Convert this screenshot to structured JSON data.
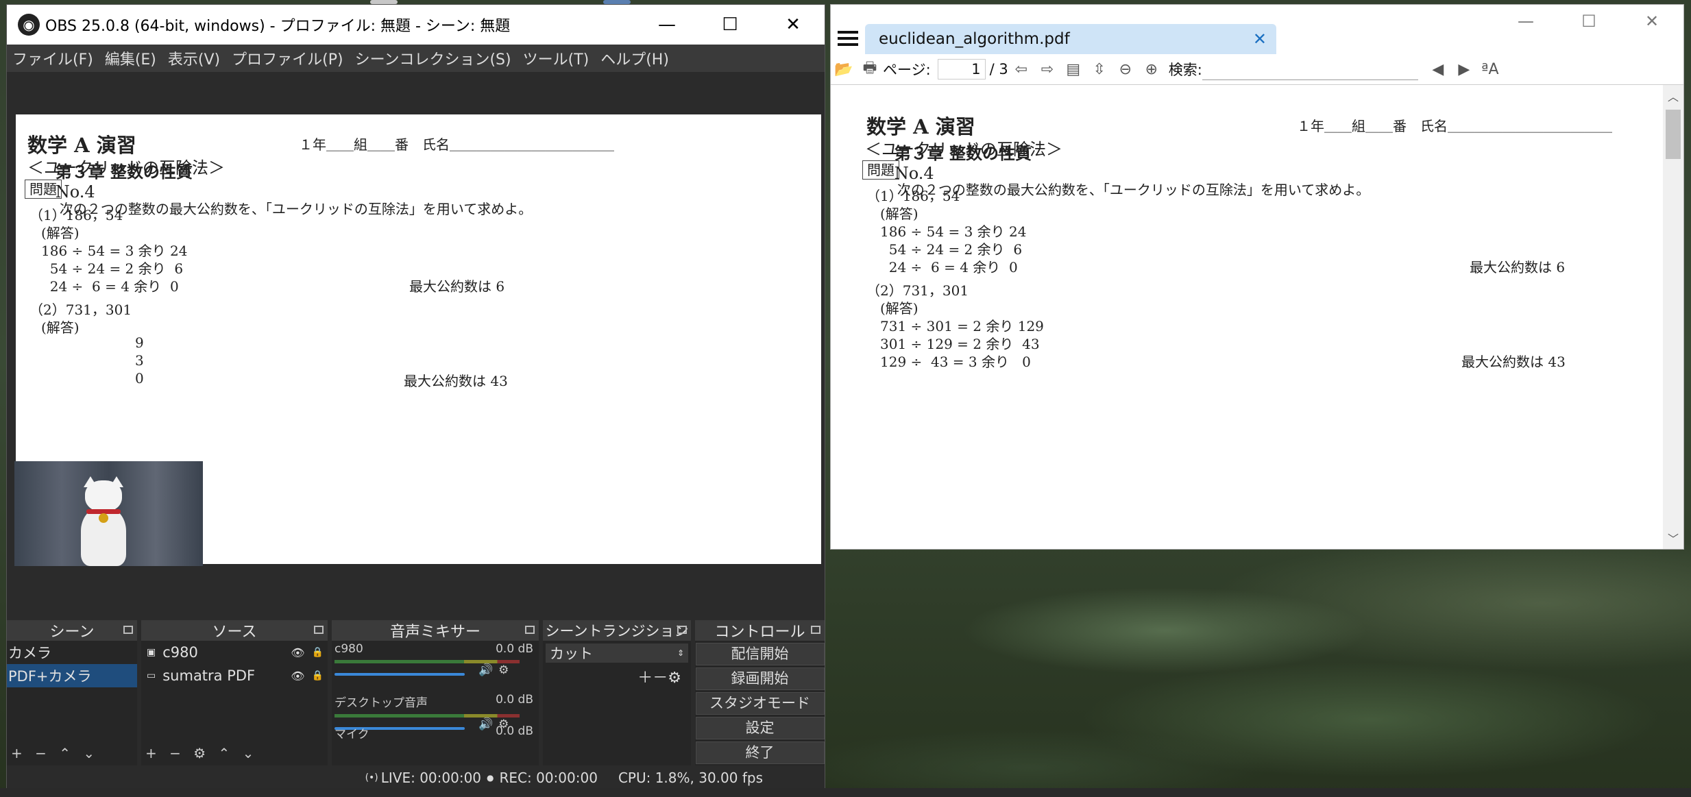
{
  "obs": {
    "title": "OBS 25.0.8 (64-bit, windows) - プロファイル: 無題 - シーン: 無題",
    "menu": [
      "ファイル(F)",
      "編集(E)",
      "表示(V)",
      "プロファイル(P)",
      "シーンコレクション(S)",
      "ツール(T)",
      "ヘルプ(H)"
    ],
    "docks": {
      "scenes": {
        "title": "シーン",
        "items": [
          "カメラ",
          "PDF+カメラ"
        ],
        "selected": 1,
        "tools": "+ − ⌃ ⌄"
      },
      "sources": {
        "title": "ソース",
        "items": [
          "c980",
          "sumatra PDF"
        ],
        "tools": "+ − ⚙ ⌃ ⌄"
      },
      "mixer": {
        "title": "音声ミキサー",
        "channels": [
          {
            "name": "c980",
            "db": "0.0 dB"
          },
          {
            "name": "デスクトップ音声",
            "db": "0.0 dB"
          },
          {
            "name": "マイク",
            "db": "0.0 dB"
          }
        ]
      },
      "transitions": {
        "title": "シーントランジション",
        "selected": "カット"
      },
      "controls": {
        "title": "コントロール",
        "buttons": [
          "配信開始",
          "録画開始",
          "スタジオモード",
          "設定",
          "終了"
        ]
      }
    },
    "status": {
      "live": "LIVE: 00:00:00",
      "rec": "REC: 00:00:00",
      "cpu": "CPU: 1.8%, 30.00 fps"
    }
  },
  "sumatra": {
    "tab_title": "euclidean_algorithm.pdf",
    "page_label": "ページ:",
    "page_current": "1",
    "page_total": "/ 3",
    "search_label": "検索:"
  },
  "pdf": {
    "title": "数学 A 演習",
    "chapter": "第３章 整数の性質",
    "no": "No.4",
    "name_line": "１年＿＿組＿＿番　氏名＿＿＿＿＿＿＿＿＿＿＿＿",
    "section": "＜ユークリッドの互除法＞",
    "problem_tag": "問題",
    "problem_text": "次の２つの整数の最大公約数を、「ユークリッドの互除法」を用いて求めよ。",
    "q1": {
      "label": "（1）186，54",
      "answer": "(解答)",
      "steps": [
        "186 ÷ 54 = 3 余り 24",
        "  54 ÷ 24 = 2 余り  6",
        "  24 ÷  6 = 4 余り  0"
      ],
      "result": "最大公約数は 6"
    },
    "q2": {
      "label": "（2）731，301",
      "answer": "(解答)",
      "steps": [
        "731 ÷ 301 = 2 余り 129",
        "301 ÷ 129 = 2 余り  43",
        "129 ÷  43 = 3 余り   0"
      ],
      "result": "最大公約数は 43"
    },
    "q2_cut": [
      "9",
      "3",
      "0"
    ]
  }
}
